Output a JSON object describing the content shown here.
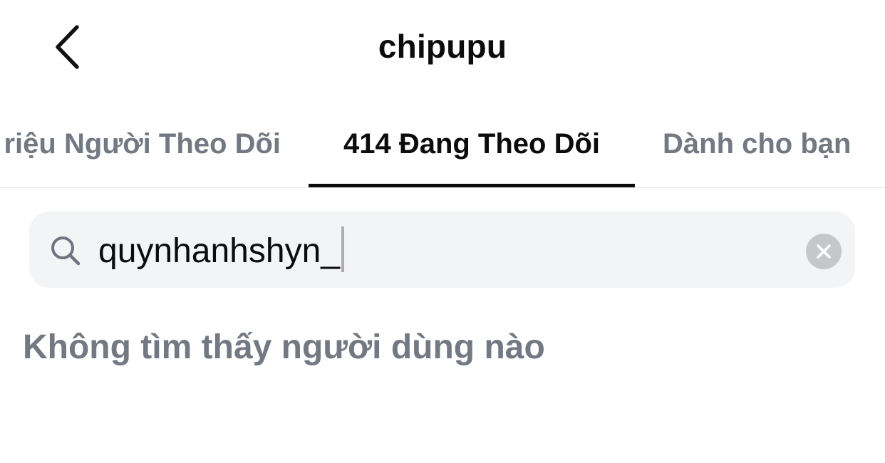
{
  "header": {
    "title": "chipupu",
    "back_icon": "chevron-left-icon"
  },
  "tabs": [
    {
      "label": "riệu Người Theo Dõi",
      "active": false
    },
    {
      "label": "414 Đang Theo Dõi",
      "active": true
    },
    {
      "label": "Dành cho bạn",
      "active": false
    }
  ],
  "search": {
    "value": "quynhanhshyn_",
    "icon": "search-icon",
    "clear_icon": "close-icon"
  },
  "results": {
    "empty_message": "Không tìm thấy người dùng nào"
  },
  "colors": {
    "text_primary": "#0c0c0c",
    "text_secondary": "#737983",
    "search_bg": "#f3f4f6",
    "clear_bg": "#c6c7c9"
  }
}
